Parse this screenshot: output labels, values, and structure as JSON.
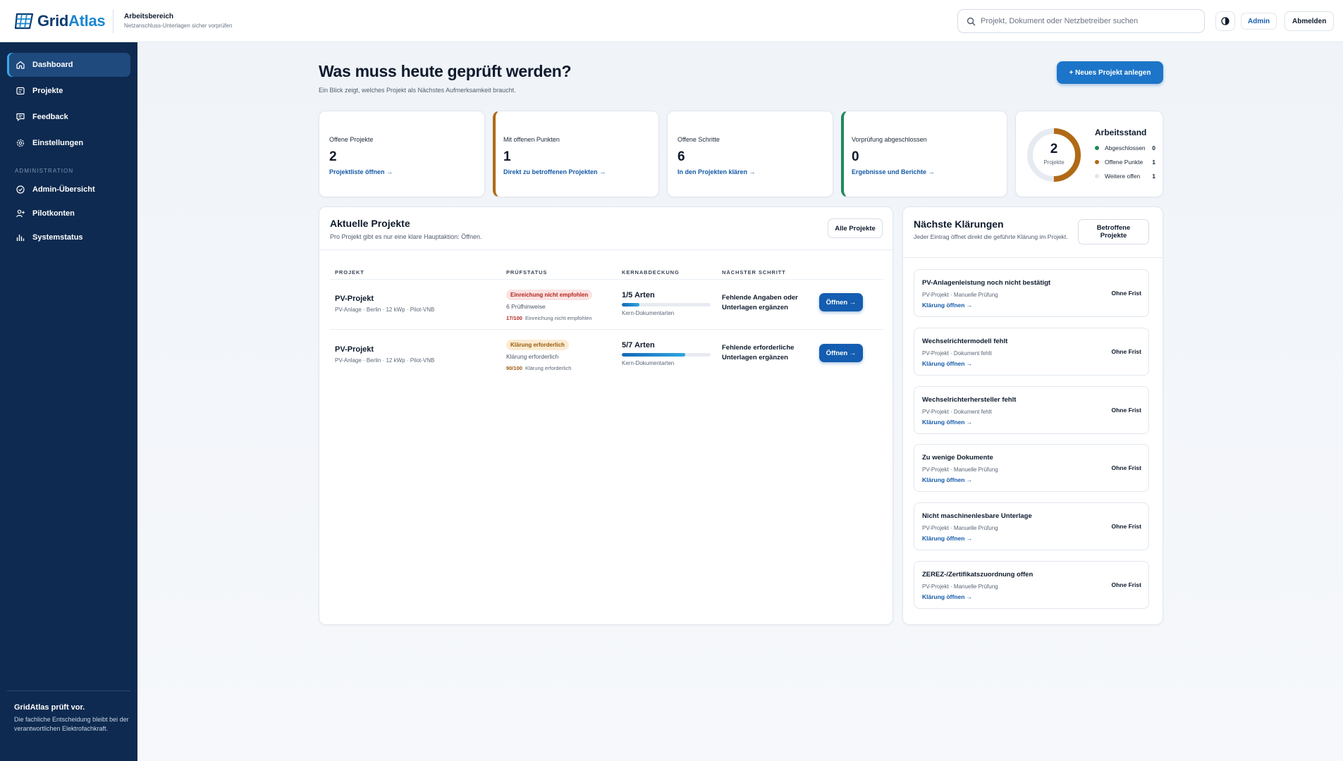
{
  "brand": {
    "name_part1": "Grid",
    "name_part2": "Atlas"
  },
  "workspace": {
    "title": "Arbeitsbereich",
    "subtitle": "Netzanschluss-Unterlagen sicher vorprüfen"
  },
  "header": {
    "search_placeholder": "Projekt, Dokument oder Netzbetreiber suchen",
    "admin_label": "Admin",
    "logout_label": "Abmelden"
  },
  "sidebar": {
    "items": [
      {
        "label": "Dashboard",
        "icon": "home-icon",
        "active": true
      },
      {
        "label": "Projekte",
        "icon": "list-icon"
      },
      {
        "label": "Feedback",
        "icon": "chat-icon"
      },
      {
        "label": "Einstellungen",
        "icon": "gear-icon"
      }
    ],
    "admin_section": "ADMINISTRATION",
    "admin_items": [
      {
        "label": "Admin-Übersicht",
        "icon": "shield-icon"
      },
      {
        "label": "Pilotkonten",
        "icon": "user-plus-icon"
      },
      {
        "label": "Systemstatus",
        "icon": "bar-chart-icon"
      }
    ],
    "footer_title": "GridAtlas prüft vor.",
    "footer_text": "Die fachliche Entscheidung bleibt bei der verantwortlichen Elektrofachkraft."
  },
  "main": {
    "title": "Was muss heute geprüft werden?",
    "subtitle": "Ein Blick zeigt, welches Projekt als Nächstes Aufmerksamkeit braucht.",
    "new_project_label": "+ Neues Projekt anlegen"
  },
  "stats": [
    {
      "label": "Offene Projekte",
      "value": "2",
      "link": "Projektliste öffnen →"
    },
    {
      "label": "Mit offenen Punkten",
      "value": "1",
      "link": "Direkt zu betroffenen Projekten →"
    },
    {
      "label": "Offene Schritte",
      "value": "6",
      "link": "In den Projekten klären →"
    },
    {
      "label": "Vorprüfung abgeschlossen",
      "value": "0",
      "link": "Ergebnisse und Berichte →"
    }
  ],
  "status_card": {
    "title": "Arbeitsstand",
    "total": "2",
    "total_caption": "Projekte",
    "legend": [
      {
        "label": "Abgeschlossen",
        "value": "0",
        "color": "#1e8a5a"
      },
      {
        "label": "Offene Punkte",
        "value": "1",
        "color": "#b06a16"
      },
      {
        "label": "Weitere offen",
        "value": "1",
        "color": "#dfe5ed"
      }
    ]
  },
  "projects_panel": {
    "title": "Aktuelle Projekte",
    "subtitle": "Pro Projekt gibt es nur eine klare Hauptaktion: Öffnen.",
    "all_button": "Alle Projekte",
    "columns": [
      "PROJEKT",
      "PRÜFSTATUS",
      "KERNABDECKUNG",
      "NÄCHSTER SCHRITT"
    ],
    "rows": [
      {
        "name": "PV-Projekt",
        "meta": "PV-Anlage · Berlin · 12 kWp · Pilot-VNB",
        "badge": "Einreichung nicht empfohlen",
        "badge_tone": "red",
        "hint": "6 Prüfhinweise",
        "score": "17/100",
        "score_text": "Einreichung nicht empfohlen",
        "coverage": "1/5 Arten",
        "coverage_fraction": 0.2,
        "coverage_caption": "Kern-Dokumentarten",
        "next_step": "Fehlende Angaben oder Unterlagen ergänzen",
        "action": "Öffnen →"
      },
      {
        "name": "PV-Projekt",
        "meta": "PV-Anlage · Berlin · 12 kWp · Pilot-VNB",
        "badge": "Klärung erforderlich",
        "badge_tone": "amber",
        "hint": "Klärung erforderlich",
        "score": "90/100",
        "score_text": "Klärung erforderlich",
        "coverage": "5/7 Arten",
        "coverage_fraction": 0.714,
        "coverage_caption": "Kern-Dokumentarten",
        "next_step": "Fehlende erforderliche Unterlagen ergänzen",
        "action": "Öffnen →"
      }
    ]
  },
  "clarifications_panel": {
    "title": "Nächste Klärungen",
    "subtitle": "Jeder Eintrag öffnet direkt die geführte Klärung im Projekt.",
    "button": "Betroffene Projekte",
    "items": [
      {
        "title": "PV-Anlagenleistung noch nicht bestätigt",
        "meta": "PV-Projekt · Manuelle Prüfung",
        "link": "Klärung öffnen →",
        "deadline": "Ohne Frist"
      },
      {
        "title": "Wechselrichtermodell fehlt",
        "meta": "PV-Projekt · Dokument fehlt",
        "link": "Klärung öffnen →",
        "deadline": "Ohne Frist"
      },
      {
        "title": "Wechselrichterhersteller fehlt",
        "meta": "PV-Projekt · Dokument fehlt",
        "link": "Klärung öffnen →",
        "deadline": "Ohne Frist"
      },
      {
        "title": "Zu wenige Dokumente",
        "meta": "PV-Projekt · Manuelle Prüfung",
        "link": "Klärung öffnen →",
        "deadline": "Ohne Frist"
      },
      {
        "title": "Nicht maschinenlesbare Unterlage",
        "meta": "PV-Projekt · Manuelle Prüfung",
        "link": "Klärung öffnen →",
        "deadline": "Ohne Frist"
      },
      {
        "title": "ZEREZ-/Zertifikatszuordnung offen",
        "meta": "PV-Projekt · Manuelle Prüfung",
        "link": "Klärung öffnen →",
        "deadline": "Ohne Frist"
      }
    ]
  }
}
